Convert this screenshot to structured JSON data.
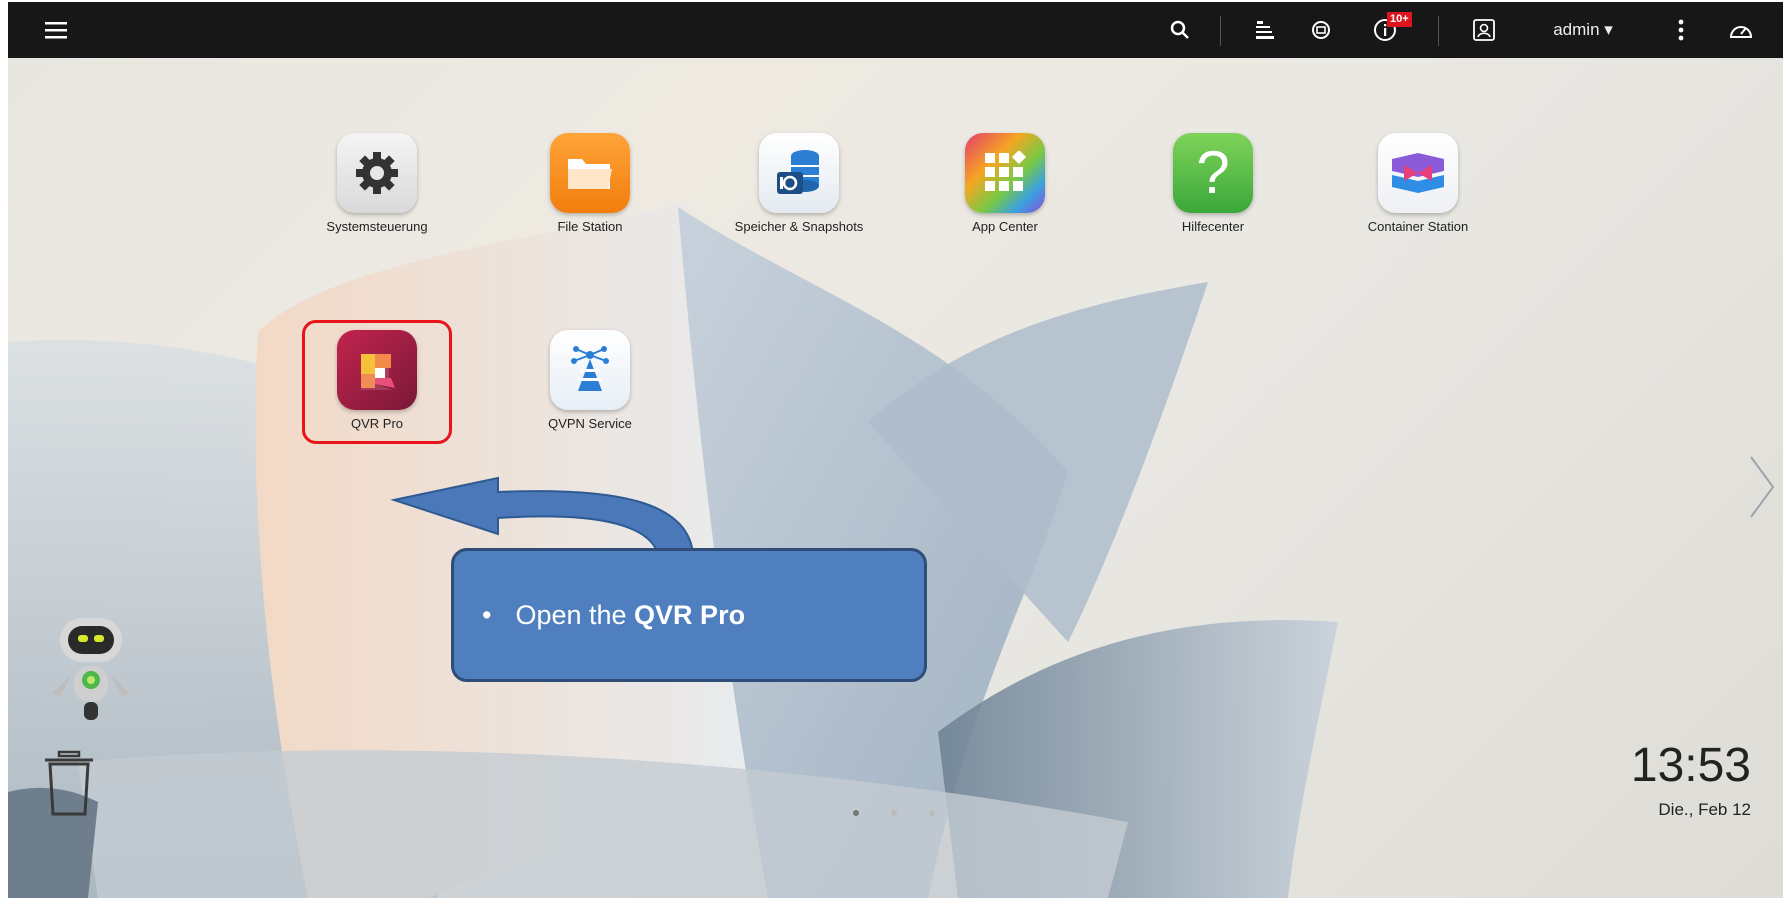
{
  "topbar": {
    "menu_icon": "hamburger-menu-icon",
    "user": "admin ▾",
    "notification_badge": "10+"
  },
  "apps": [
    {
      "label": "Systemsteuerung",
      "icon": "gear-icon"
    },
    {
      "label": "File Station",
      "icon": "folder-icon"
    },
    {
      "label": "Speicher & Snapshots",
      "icon": "storage-icon"
    },
    {
      "label": "App Center",
      "icon": "app-grid-icon"
    },
    {
      "label": "Hilfecenter",
      "icon": "question-icon"
    },
    {
      "label": "Container Station",
      "icon": "container-icon"
    },
    {
      "label": "QVR Pro",
      "icon": "qvr-pro-icon"
    },
    {
      "label": "QVPN Service",
      "icon": "vpn-icon"
    }
  ],
  "callout": {
    "bullet": "•",
    "text": "Open the ",
    "emphasis": "QVR Pro"
  },
  "clock": {
    "time": "13:53",
    "date": "Die., Feb 12"
  },
  "colors": {
    "topbar": "#171717",
    "highlight": "#e8141a",
    "callout": "#4f7fbe",
    "arrow": "#4a78b8"
  }
}
